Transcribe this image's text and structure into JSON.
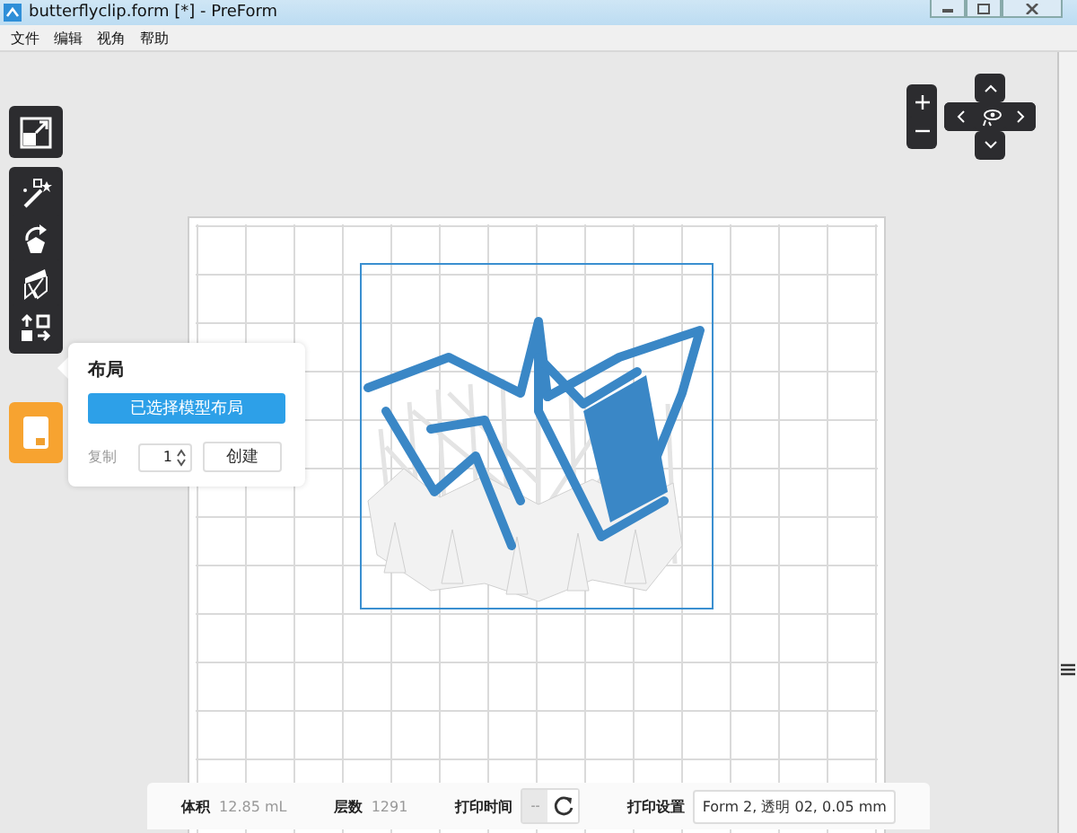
{
  "window": {
    "title": "butterflyclip.form [*] - PreForm"
  },
  "menu": [
    "文件",
    "编辑",
    "视角",
    "帮助"
  ],
  "popover": {
    "title": "布局",
    "primary_button": "已选择模型布局",
    "copies_label": "复制",
    "copies_value": "1",
    "create_button": "创建"
  },
  "status_bar": {
    "stats": [
      {
        "label": "体积",
        "value": "12.85 mL"
      },
      {
        "label": "层数",
        "value": "1291"
      }
    ],
    "print_time": {
      "label": "打印时间",
      "value": "--"
    },
    "print_settings": {
      "label": "打印设置",
      "value": "Form 2, 透明 02, 0.05 mm"
    }
  }
}
